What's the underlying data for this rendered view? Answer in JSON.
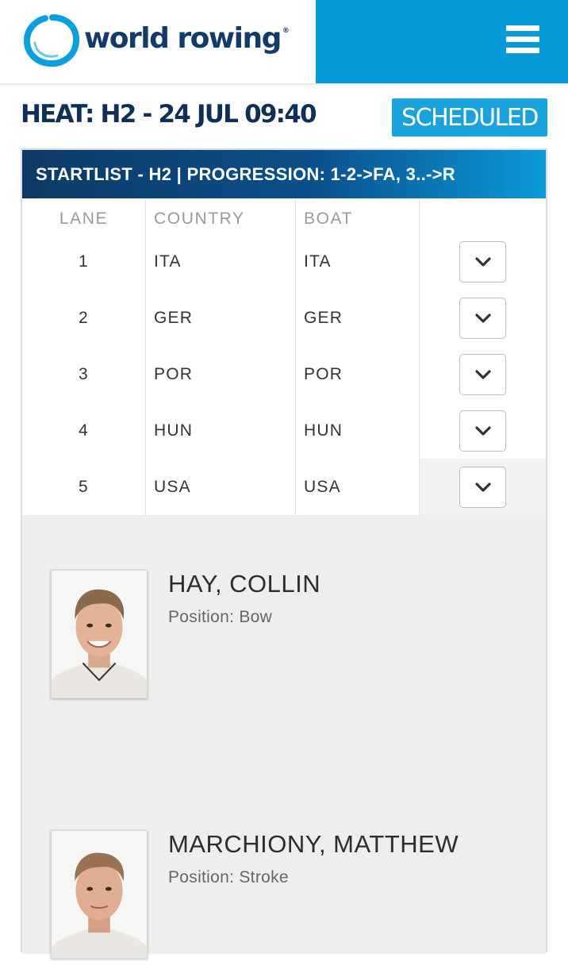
{
  "header": {
    "logo_text": "world rowing",
    "logo_mark": "®",
    "logo_color": "#123a6b",
    "accent_color": "#069ad8",
    "menu_icon": "hamburger-menu-icon"
  },
  "heat": {
    "title": "HEAT: H2 - 24 JUL 09:40",
    "status": "SCHEDULED",
    "status_color": "#1aa2dc"
  },
  "startlist": {
    "header": "STARTLIST - H2 | PROGRESSION: 1-2->FA, 3..->R",
    "columns": {
      "lane": "LANE",
      "country": "COUNTRY",
      "boat": "BOAT"
    },
    "rows": [
      {
        "lane": "1",
        "country": "ITA",
        "boat": "ITA"
      },
      {
        "lane": "2",
        "country": "GER",
        "boat": "GER"
      },
      {
        "lane": "3",
        "country": "POR",
        "boat": "POR"
      },
      {
        "lane": "4",
        "country": "HUN",
        "boat": "HUN"
      },
      {
        "lane": "5",
        "country": "USA",
        "boat": "USA"
      }
    ],
    "expand_icon": "chevron-down-icon"
  },
  "crew": [
    {
      "name": "HAY, COLLIN",
      "position": "Position: Bow"
    },
    {
      "name": "MARCHIONY, MATTHEW",
      "position": "Position: Stroke"
    }
  ]
}
